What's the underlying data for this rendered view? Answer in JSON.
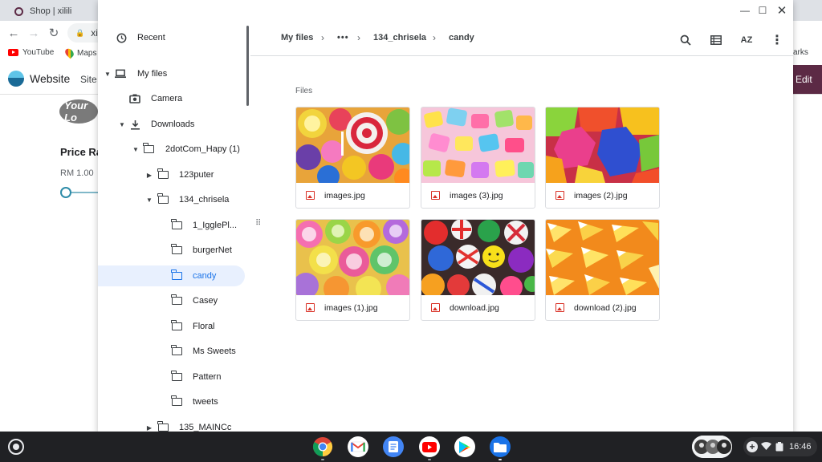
{
  "browser": {
    "tab_title": "Shop | xilili",
    "address": "xi",
    "bookmarks": [
      "YouTube",
      "Maps"
    ],
    "bookmarks_right": "arks"
  },
  "website": {
    "title": "Website",
    "nav": "Site",
    "edit_label": "Edit",
    "logo_text": "Your Lo",
    "price_label": "Price Ra",
    "price_value": "RM 1.00",
    "price_slider_fraction": 0
  },
  "files": {
    "sidebar": {
      "recent": "Recent",
      "my_files": "My files",
      "camera": "Camera",
      "downloads": "Downloads",
      "folders": [
        "2dotCom_Hapy (1)",
        "123puter",
        "134_chrisela",
        "1_IgglePl...",
        "burgerNet",
        "candy",
        "Casey",
        "Floral",
        "Ms Sweets",
        "Pattern",
        "tweets",
        "135_MAINCc"
      ]
    },
    "breadcrumb": [
      "My files",
      "134_chrisela",
      "candy"
    ],
    "section_label": "Files",
    "items": [
      {
        "name": "images.jpg"
      },
      {
        "name": "images (3).jpg"
      },
      {
        "name": "images (2).jpg"
      },
      {
        "name": "images (1).jpg"
      },
      {
        "name": "download.jpg"
      },
      {
        "name": "download (2).jpg"
      }
    ],
    "sort_label": "AZ"
  },
  "shelf": {
    "time": "16:46",
    "apps": [
      "chrome-icon",
      "gmail-icon",
      "docs-icon",
      "youtube-icon",
      "play-store-icon",
      "files-icon"
    ]
  },
  "colors": {
    "accent": "#1a73e8",
    "edit_button": "#5c2a45",
    "shelf": "#202124"
  }
}
